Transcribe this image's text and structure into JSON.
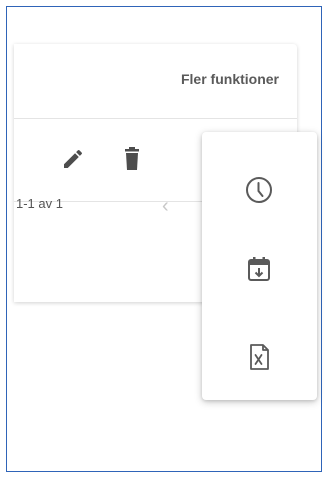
{
  "header": {
    "more_functions_label": "Fler funktioner"
  },
  "actions": {
    "edit_icon": "pencil-icon",
    "delete_icon": "trash-icon"
  },
  "pagination": {
    "range_text": "1-1 av 1",
    "prev_icon": "chevron-left-icon"
  },
  "menu": {
    "items": [
      {
        "icon": "clock-icon"
      },
      {
        "icon": "calendar-download-icon"
      },
      {
        "icon": "excel-file-icon"
      }
    ]
  },
  "colors": {
    "frame_border": "#2f64b8",
    "icon_dark": "#4d4d4d",
    "icon_menu": "#5a5a5a",
    "text_muted": "#555555",
    "chevron": "#c8c8c8"
  }
}
